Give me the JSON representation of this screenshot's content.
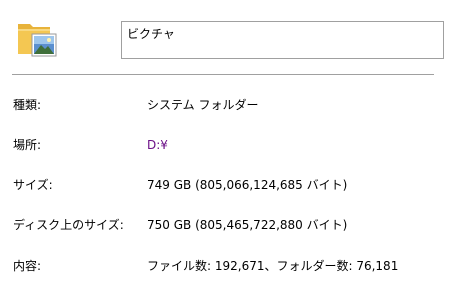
{
  "header": {
    "icon": "pictures-folder-icon",
    "name_value": "ビクチャ"
  },
  "properties": [
    {
      "label": "種類:",
      "value": "システム フォルダー"
    },
    {
      "label": "場所:",
      "value": "D:¥"
    },
    {
      "label": "サイズ:",
      "value": "749 GB (805,066,124,685 バイト)"
    },
    {
      "label": "ディスク上のサイズ:",
      "value": "750 GB (805,465,722,880 バイト)"
    },
    {
      "label": "内容:",
      "value": "ファイル数: 192,671、フォルダー数: 76,181"
    }
  ],
  "colors": {
    "divider": "#a0a0a0",
    "location_text": "#6b0f87",
    "folder_yellow": "#f4c752"
  }
}
